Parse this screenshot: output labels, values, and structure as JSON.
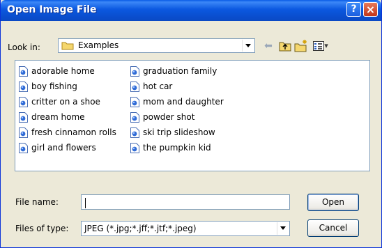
{
  "window": {
    "title": "Open Image File",
    "help_glyph": "?",
    "close_glyph": "×"
  },
  "lookin": {
    "label": "Look in:",
    "value": "Examples"
  },
  "toolbar": {
    "back_glyph": "⬅",
    "view_menu_glyph": "▾"
  },
  "files": {
    "column1": [
      "adorable home",
      "boy fishing",
      "critter on a shoe",
      "dream home",
      "fresh cinnamon rolls",
      "girl and flowers"
    ],
    "column2": [
      "graduation family",
      "hot car",
      "mom and daughter",
      "powder shot",
      "ski trip slideshow",
      "the pumpkin kid"
    ]
  },
  "filename": {
    "label": "File name:",
    "value": ""
  },
  "filetype": {
    "label": "Files of type:",
    "value": "JPEG (*.jpg;*.jff;*.jtf;*.jpeg)"
  },
  "buttons": {
    "open": "Open",
    "cancel": "Cancel"
  }
}
